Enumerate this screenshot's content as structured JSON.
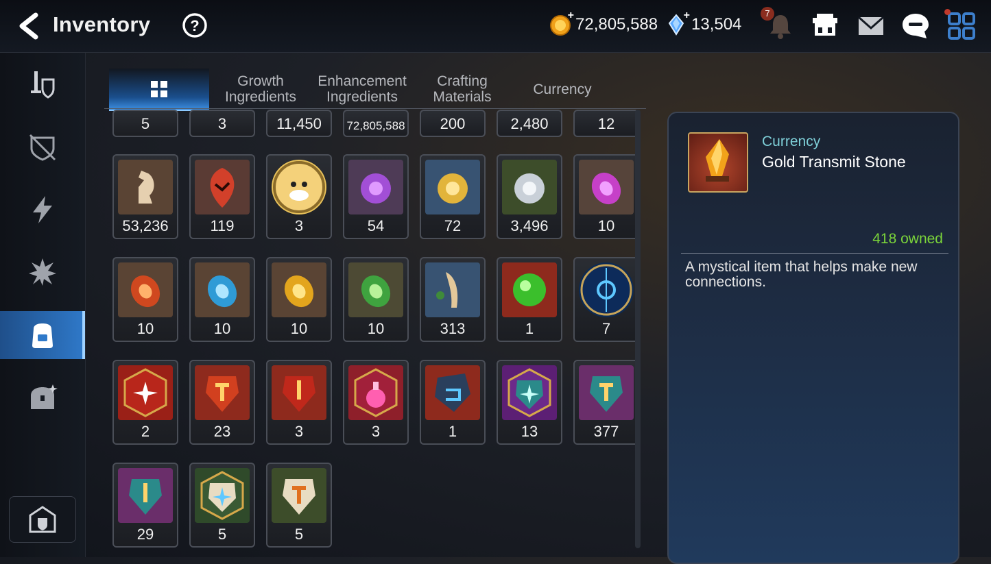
{
  "header": {
    "title": "Inventory",
    "gold": "72,805,588",
    "crystals": "13,504",
    "notification_count": "7"
  },
  "tabs": [
    {
      "label": ""
    },
    {
      "label": "Growth Ingredients"
    },
    {
      "label": "Enhancement Ingredients"
    },
    {
      "label": "Crafting Materials"
    },
    {
      "label": "Currency"
    }
  ],
  "items": {
    "row0": [
      "5",
      "3",
      "11,450",
      "72,805,588",
      "200",
      "2,480",
      "12"
    ],
    "row1": [
      "53,236",
      "119",
      "3",
      "54",
      "72",
      "3,496",
      "10"
    ],
    "row2": [
      "10",
      "10",
      "10",
      "10",
      "313",
      "1",
      "7"
    ],
    "row3": [
      "2",
      "23",
      "3",
      "3",
      "1",
      "13",
      "377"
    ],
    "row4": [
      "29",
      "5",
      "5"
    ]
  },
  "detail": {
    "category": "Currency",
    "name": "Gold Transmit Stone",
    "owned": "418 owned",
    "description": "A mystical item that helps make new connections."
  },
  "colors": {
    "accent_blue": "#2f79c9",
    "owned_green": "#7bd53a",
    "category_teal": "#7ecfd8"
  }
}
